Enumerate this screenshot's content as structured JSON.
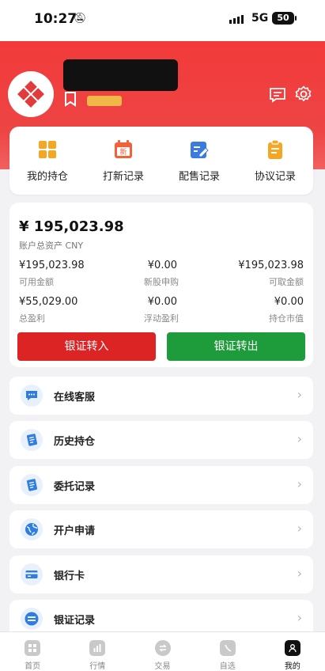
{
  "status_bar": {
    "time": "10:27",
    "network": "5G",
    "battery": "50"
  },
  "header": {
    "colors": {
      "brand": "#ef3b3b"
    }
  },
  "quick_actions": [
    {
      "label": "我的持仓",
      "icon": "grid-icon"
    },
    {
      "label": "打新记录",
      "icon": "calendar-new-icon"
    },
    {
      "label": "配售记录",
      "icon": "edit-note-icon"
    },
    {
      "label": "协议记录",
      "icon": "clipboard-icon"
    }
  ],
  "assets": {
    "total": "¥ 195,023.98",
    "total_label": "账户总资产 CNY",
    "available": {
      "value": "¥195,023.98",
      "label": "可用金额"
    },
    "ipo_purchase": {
      "value": "¥0.00",
      "label": "新股申购"
    },
    "withdrawable": {
      "value": "¥195,023.98",
      "label": "可取金额"
    },
    "total_pnl": {
      "value": "¥55,029.00",
      "label": "总盈利"
    },
    "floating_pnl": {
      "value": "¥0.00",
      "label": "浮动盈利"
    },
    "position_value": {
      "value": "¥0.00",
      "label": "持仓市值"
    },
    "transfer_in_label": "银证转入",
    "transfer_out_label": "银证转出"
  },
  "menu": [
    {
      "label": "在线客服",
      "icon": "chat-bubble-icon"
    },
    {
      "label": "历史持仓",
      "icon": "document-icon"
    },
    {
      "label": "委托记录",
      "icon": "document-icon"
    },
    {
      "label": "开户申请",
      "icon": "globe-icon"
    },
    {
      "label": "银行卡",
      "icon": "bank-card-icon"
    },
    {
      "label": "银证记录",
      "icon": "transfer-icon"
    }
  ],
  "tabbar": [
    {
      "label": "首页"
    },
    {
      "label": "行情"
    },
    {
      "label": "交易"
    },
    {
      "label": "自选"
    },
    {
      "label": "我的"
    }
  ]
}
